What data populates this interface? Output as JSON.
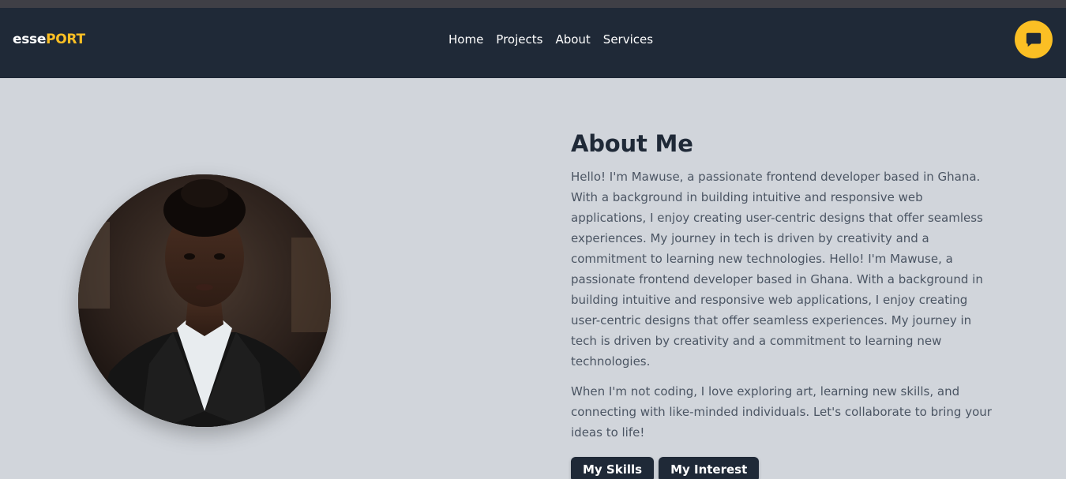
{
  "nav": {
    "logo_primary": "esse",
    "logo_accent": "PORT",
    "links": [
      "Home",
      "Projects",
      "About",
      "Services"
    ],
    "chat_icon": "chat-bubble-icon"
  },
  "about": {
    "title": "About Me",
    "paragraphs": [
      "Hello! I'm Mawuse, a passionate frontend developer based in Ghana. With a background in building intuitive and responsive web applications, I enjoy creating user-centric designs that offer seamless experiences. My journey in tech is driven by creativity and a commitment to learning new technologies. Hello! I'm Mawuse, a passionate frontend developer based in Ghana. With a background in building intuitive and responsive web applications, I enjoy creating user-centric designs that offer seamless experiences. My journey in tech is driven by creativity and a commitment to learning new technologies.",
      "When I'm not coding, I love exploring art, learning new skills, and connecting with like-minded individuals. Let's collaborate to bring your ideas to life!"
    ],
    "buttons": [
      "My Skills",
      "My Interest"
    ]
  },
  "colors": {
    "nav_bg": "#1f2937",
    "accent": "#fbbf24",
    "page_bg": "#d1d5db",
    "text_muted": "#4b5563"
  }
}
